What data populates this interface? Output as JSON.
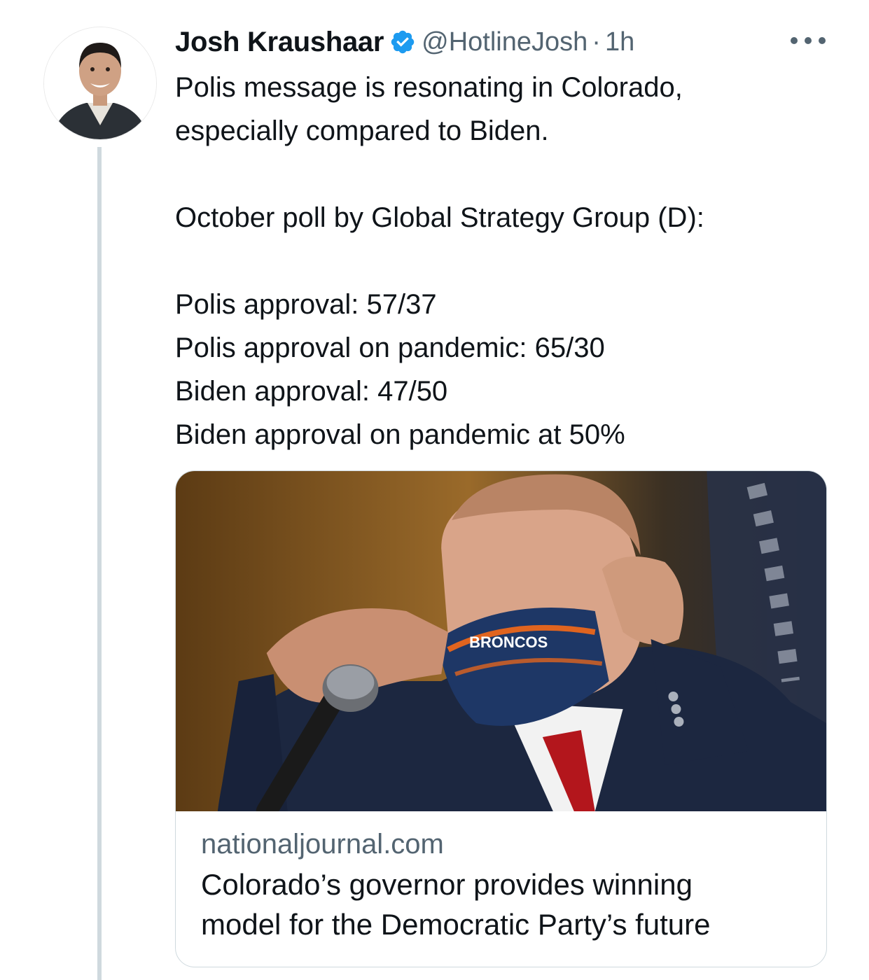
{
  "tweet": {
    "author_name": "Josh Kraushaar",
    "handle": "@HotlineJosh",
    "separator": "·",
    "time": "1h",
    "verified_color": "#1d9bf0",
    "text_lines": [
      "Polis message is resonating in Colorado,",
      "especially compared to Biden.",
      "",
      "October poll by Global Strategy Group (D):",
      "",
      "Polis approval: 57/37",
      "Polis approval on pandemic: 65/30",
      "Biden approval: 47/50",
      "Biden approval on pandemic at 50%"
    ]
  },
  "card": {
    "domain": "nationaljournal.com",
    "title_line1": "Colorado’s governor provides winning",
    "title_line2": "model for the Democratic Party’s future",
    "mask_text": "BRONCOS"
  },
  "colors": {
    "text": "#0f1419",
    "secondary": "#536471",
    "border": "#cfd9de",
    "thread_line": "#cfd9de"
  }
}
